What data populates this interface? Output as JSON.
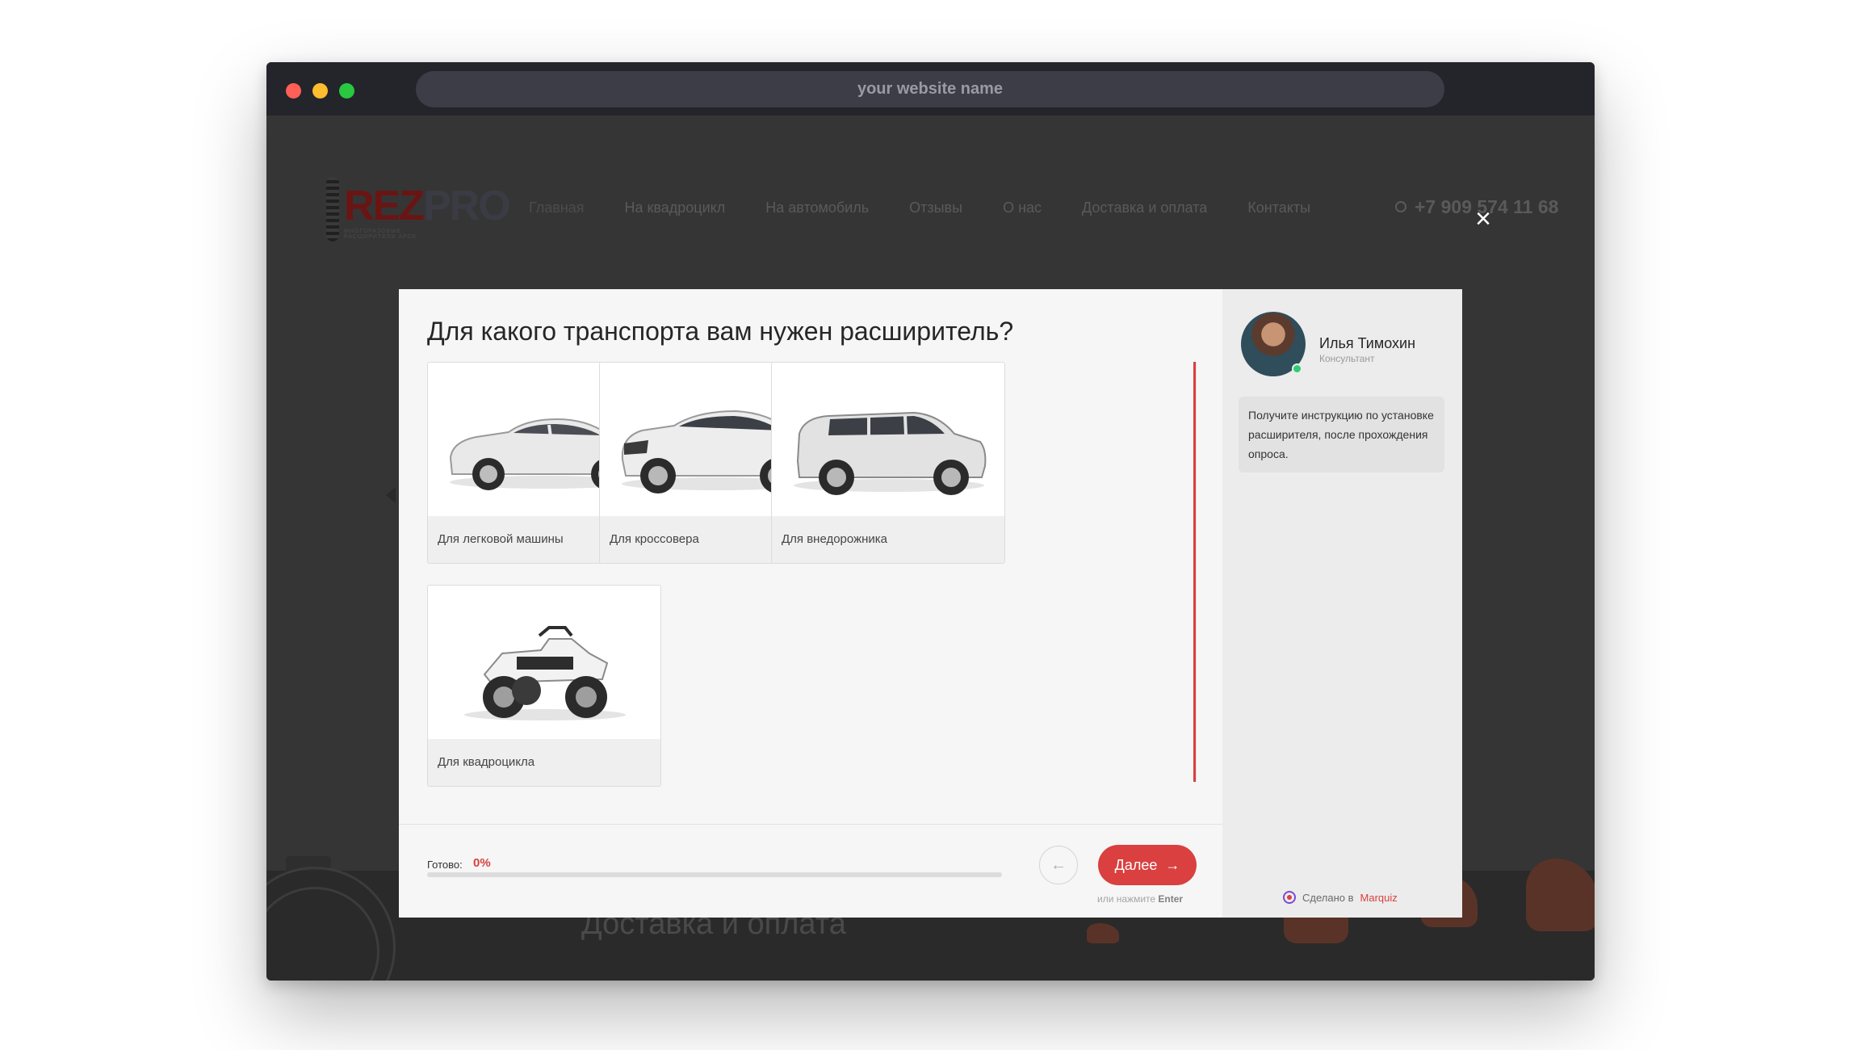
{
  "browser": {
    "url_placeholder": "your website name"
  },
  "site": {
    "logo": "REZPRO",
    "logo_sub": "МНОГОРАЗОВЫЕ РАСШИРИТЕЛИ АРОК",
    "nav": [
      "Главная",
      "На квадроцикл",
      "На автомобиль",
      "Отзывы",
      "О нас",
      "Доставка и оплата",
      "Контакты"
    ],
    "phone": "+7 909 574 11 68",
    "section_heading": "Доставка и оплата"
  },
  "quiz": {
    "question": "Для какого транспорта вам нужен расширитель?",
    "options": [
      {
        "label": "Для легковой машины",
        "icon": "sedan-car-image"
      },
      {
        "label": "Для кроссовера",
        "icon": "crossover-car-image"
      },
      {
        "label": "Для внедорожника",
        "icon": "suv-car-image"
      },
      {
        "label": "Для квадроцикла",
        "icon": "atv-image"
      }
    ],
    "progress_label": "Готово:",
    "progress_value": "0%",
    "progress_fraction": 0,
    "next_label": "Далее",
    "enter_hint_prefix": "или нажмите",
    "enter_hint_key": "Enter"
  },
  "consultant": {
    "name": "Илья Тимохин",
    "role": "Консультант",
    "message": "Получите инструкцию по установке расширителя, после прохождения опроса."
  },
  "footer": {
    "made_in": "Сделано в",
    "brand": "Marquiz"
  },
  "colors": {
    "accent": "#d9403f",
    "titlebar": "#24242b",
    "online": "#2ecc71"
  }
}
